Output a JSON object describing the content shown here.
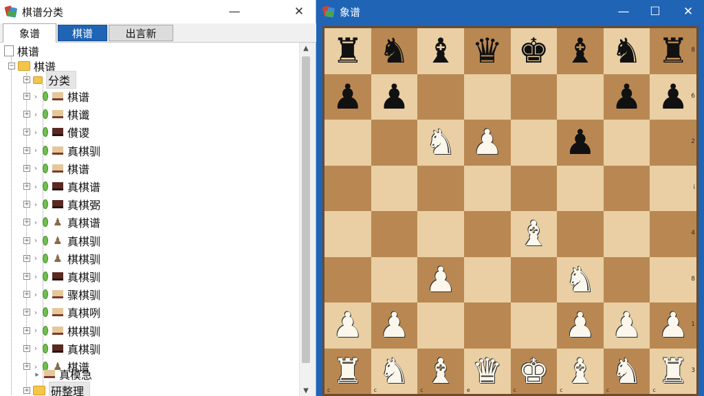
{
  "left_window": {
    "title": "棋谱分类",
    "buttons": {
      "minimize": "—",
      "close": "✕"
    },
    "tabs": [
      "象谱",
      "棋谱",
      "出言新"
    ],
    "tree": {
      "root_doc_label": "棋谱",
      "root_folder_label": "棋谱",
      "category_label": "分类",
      "items": [
        "棋谱",
        "棋谶",
        "儧谡",
        "真棋驯",
        "棋谱",
        "真棋谱",
        "真棋弻",
        "真棋谱",
        "真棋驯",
        "棋棋驯",
        "真棋驯",
        "骤棋驯",
        "真棋咧",
        "棋棋驯",
        "真棋驯",
        "棋谱"
      ],
      "bottom_items": [
        "真模急",
        "研整理"
      ]
    }
  },
  "right_window": {
    "title": "象谱",
    "buttons": {
      "minimize": "—",
      "maximize": "☐",
      "close": "✕"
    },
    "board": {
      "rows": [
        [
          "r",
          "n",
          "b",
          "q",
          "k",
          "b",
          "n",
          "r"
        ],
        [
          "p",
          "p",
          "",
          "",
          "",
          "",
          "p",
          "p"
        ],
        [
          "",
          "",
          "N",
          "P",
          "",
          "p",
          "",
          ""
        ],
        [
          "",
          "",
          "",
          "",
          "",
          "",
          "",
          ""
        ],
        [
          "",
          "",
          "",
          "",
          "B",
          "",
          "",
          ""
        ],
        [
          "",
          "",
          "P",
          "",
          "",
          "N",
          "",
          ""
        ],
        [
          "P",
          "P",
          "",
          "",
          "",
          "P",
          "P",
          "P"
        ],
        [
          "R",
          "N",
          "B",
          "Q",
          "K",
          "B",
          "N",
          "R"
        ]
      ],
      "rank_labels": [
        "8",
        "6",
        "2",
        "i",
        "4",
        "8",
        "1",
        "3"
      ],
      "file_labels": [
        "c",
        "c",
        "c",
        "e",
        "c",
        "c",
        "c",
        "c"
      ]
    },
    "colors": {
      "light_square": "#e9cfa3",
      "dark_square": "#b98852",
      "frame": "#1f64b5"
    }
  }
}
